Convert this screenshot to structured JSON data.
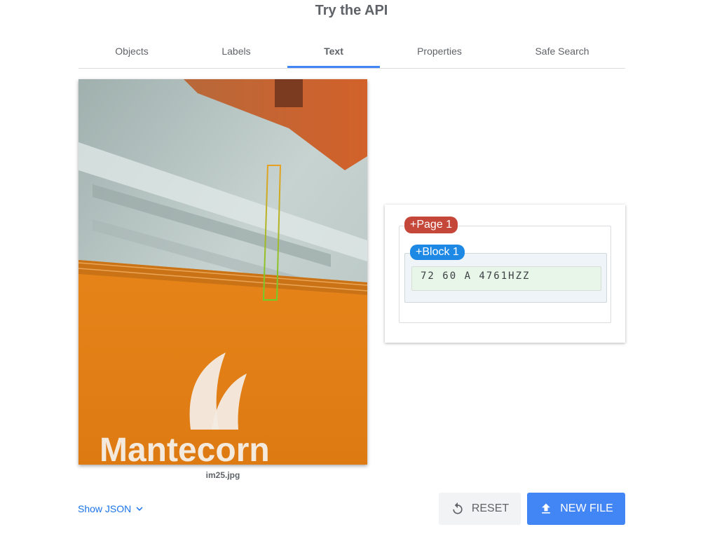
{
  "header": {
    "title": "Try the API"
  },
  "tabs": [
    {
      "label": "Objects",
      "active": false
    },
    {
      "label": "Labels",
      "active": false
    },
    {
      "label": "Text",
      "active": true
    },
    {
      "label": "Properties",
      "active": false
    },
    {
      "label": "Safe Search",
      "active": false
    }
  ],
  "image": {
    "filename": "im25.jpg"
  },
  "results": {
    "page_label": "+Page 1",
    "block_label": "+Block 1",
    "text": "72 60 A 4761HZZ"
  },
  "footer": {
    "show_json_label": "Show JSON",
    "reset_label": "RESET",
    "new_file_label": "NEW FILE"
  },
  "colors": {
    "accent": "#4285f4",
    "page_badge": "#c5473a",
    "block_badge": "#1e88e5",
    "link": "#1a73e8"
  },
  "icons": [
    "chevron-down-icon",
    "reset-icon",
    "upload-icon"
  ]
}
